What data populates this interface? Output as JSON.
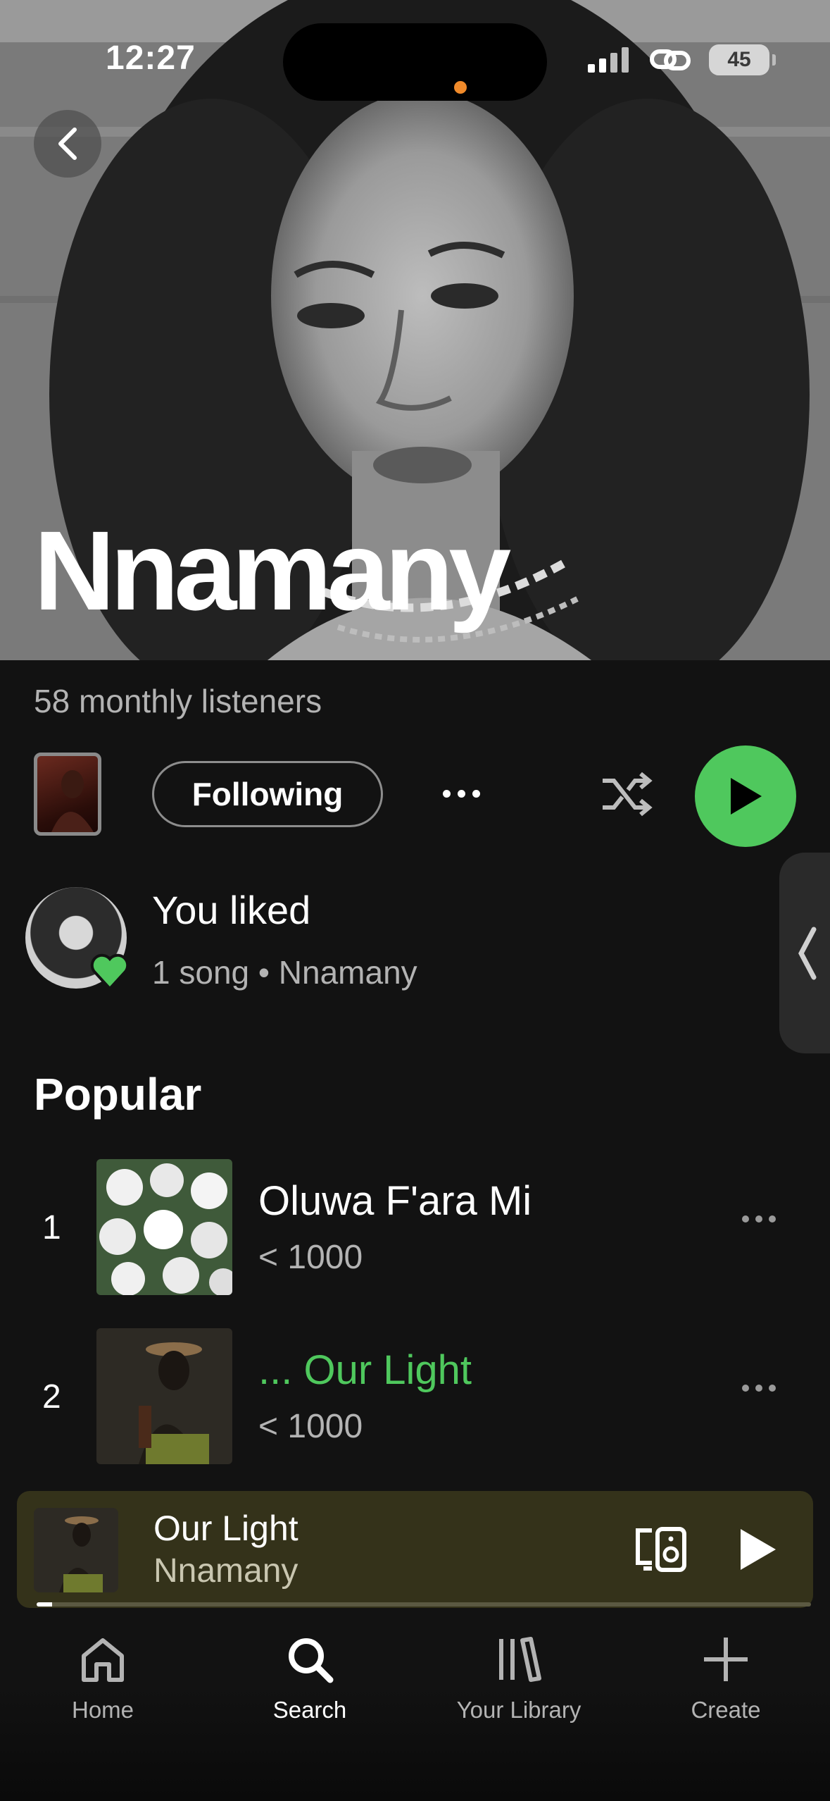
{
  "status_bar": {
    "time": "12:27",
    "battery": "45"
  },
  "artist": {
    "name": "Nnamany",
    "monthly_listeners": "58 monthly listeners",
    "follow_label": "Following"
  },
  "liked": {
    "title": "You liked",
    "subtitle": "1 song • Nnamany"
  },
  "popular": {
    "title": "Popular",
    "tracks": [
      {
        "rank": "1",
        "title": "Oluwa F'ara Mi",
        "plays": "< 1000",
        "active": false
      },
      {
        "rank": "2",
        "title": "... Our Light",
        "plays": "< 1000",
        "active": true
      }
    ]
  },
  "now_playing": {
    "title": "Our Light",
    "artist": "Nnamany",
    "progress": 0.02
  },
  "tabbar": {
    "home": "Home",
    "search": "Search",
    "library": "Your Library",
    "create": "Create"
  },
  "colors": {
    "accent_green": "#4fc85d",
    "mini_player_bg": "#34321a",
    "background": "#121212"
  }
}
